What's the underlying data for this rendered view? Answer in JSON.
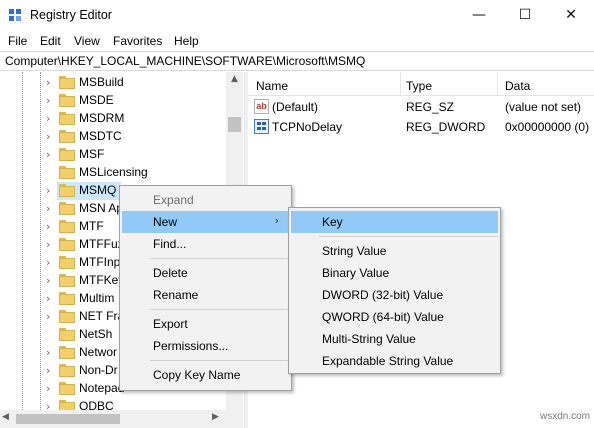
{
  "window": {
    "title": "Registry Editor",
    "controls": {
      "minimize": "—",
      "maximize": "☐",
      "close": "✕"
    },
    "icon": "registry-icon"
  },
  "menubar": [
    "File",
    "Edit",
    "View",
    "Favorites",
    "Help"
  ],
  "address": "Computer\\HKEY_LOCAL_MACHINE\\SOFTWARE\\Microsoft\\MSMQ",
  "tree": {
    "items": [
      {
        "label": "MSBuild",
        "expandable": true
      },
      {
        "label": "MSDE",
        "expandable": true
      },
      {
        "label": "MSDRM",
        "expandable": true
      },
      {
        "label": "MSDTC",
        "expandable": true
      },
      {
        "label": "MSF",
        "expandable": true
      },
      {
        "label": "MSLicensing",
        "expandable": false
      },
      {
        "label": "MSMQ",
        "expandable": true,
        "selected": true
      },
      {
        "label": "MSN Ap",
        "expandable": true
      },
      {
        "label": "MTF",
        "expandable": true
      },
      {
        "label": "MTFFuz",
        "expandable": true
      },
      {
        "label": "MTFInp",
        "expandable": true
      },
      {
        "label": "MTFKey",
        "expandable": true
      },
      {
        "label": "Multim",
        "expandable": true
      },
      {
        "label": "NET Fra",
        "expandable": true
      },
      {
        "label": "NetSh",
        "expandable": false
      },
      {
        "label": "Networ",
        "expandable": true
      },
      {
        "label": "Non-Dr",
        "expandable": true
      },
      {
        "label": "Notepad",
        "expandable": true
      },
      {
        "label": "ODBC",
        "expandable": true
      }
    ],
    "scroll_up": "▲",
    "scroll_left": "◀",
    "scroll_right": "▶"
  },
  "list": {
    "columns": [
      "Name",
      "Type",
      "Data"
    ],
    "rows": [
      {
        "icon": "string-value-icon",
        "icon_text": "ab",
        "name": "(Default)",
        "type": "REG_SZ",
        "data": "(value not set)"
      },
      {
        "icon": "binary-value-icon",
        "name": "TCPNoDelay",
        "type": "REG_DWORD",
        "data": "0x00000000 (0)"
      }
    ]
  },
  "context_menu": {
    "items": [
      {
        "label": "Expand",
        "disabled": true
      },
      {
        "label": "New",
        "submenu": true,
        "highlighted": true,
        "arrow": "›"
      },
      {
        "label": "Find..."
      },
      {
        "separator": true
      },
      {
        "label": "Delete"
      },
      {
        "label": "Rename"
      },
      {
        "separator": true
      },
      {
        "label": "Export"
      },
      {
        "label": "Permissions..."
      },
      {
        "separator": true
      },
      {
        "label": "Copy Key Name"
      }
    ]
  },
  "submenu": {
    "items": [
      {
        "label": "Key",
        "highlighted": true
      },
      {
        "separator": true
      },
      {
        "label": "String Value"
      },
      {
        "label": "Binary Value"
      },
      {
        "label": "DWORD (32-bit) Value"
      },
      {
        "label": "QWORD (64-bit) Value"
      },
      {
        "label": "Multi-String Value"
      },
      {
        "label": "Expandable String Value"
      }
    ]
  },
  "watermark": "wsxdn.com",
  "colors": {
    "highlight": "#91c9f7",
    "selection": "#cce8ff",
    "folder": "#f2cf6b"
  }
}
